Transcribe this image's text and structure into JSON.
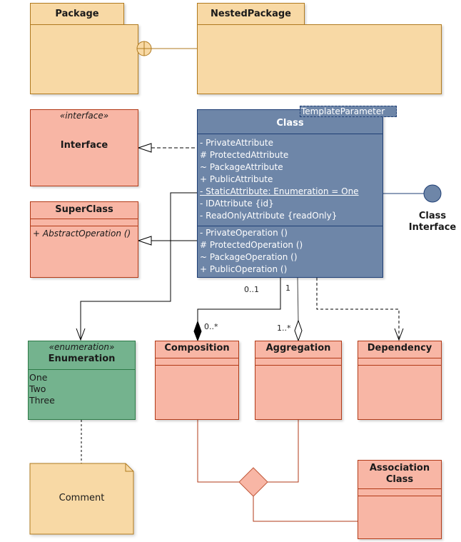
{
  "diagram": {
    "packages": {
      "package": {
        "title": "Package"
      },
      "nested_package": {
        "title": "NestedPackage"
      }
    },
    "interface_box": {
      "stereotype": "«interface»",
      "title": "Interface"
    },
    "superclass": {
      "title": "SuperClass",
      "operations": [
        "+ AbstractOperation ()"
      ]
    },
    "class_box": {
      "title": "Class",
      "template_parameter": "TemplateParameter",
      "attributes": [
        "- PrivateAttribute",
        "# ProtectedAttribute",
        "~ PackageAttribute",
        "+ PublicAttribute",
        "- StaticAttribute: Enumeration = One",
        "- IDAttribute {id}",
        "- ReadOnlyAttribute {readOnly}"
      ],
      "operations": [
        "- PrivateOperation ()",
        "# ProtectedOperation ()",
        "~ PackageOperation ()",
        "+ PublicOperation ()"
      ]
    },
    "class_interface": {
      "line1": "Class",
      "line2": "Interface"
    },
    "enumeration": {
      "stereotype": "«enumeration»",
      "title": "Enumeration",
      "literals": [
        "One",
        "Two",
        "Three"
      ]
    },
    "composition": {
      "title": "Composition"
    },
    "aggregation": {
      "title": "Aggregation"
    },
    "dependency": {
      "title": "Dependency"
    },
    "comment": {
      "text": "Comment"
    },
    "association_class": {
      "line1": "Association",
      "line2": "Class"
    },
    "multiplicities": {
      "class_composition_source": "0..1",
      "composition_target": "0..*",
      "class_aggregation_source": "1",
      "aggregation_target": "1..*"
    },
    "colors": {
      "package_fill": "#f8d9a5",
      "package_border": "#b07a1f",
      "class_fill": "#6e86a8",
      "class_border": "#1f3f75",
      "salmon_fill": "#f8b6a5",
      "salmon_border": "#b23a17",
      "enum_fill": "#74b38e",
      "enum_border": "#2d7a47"
    }
  }
}
